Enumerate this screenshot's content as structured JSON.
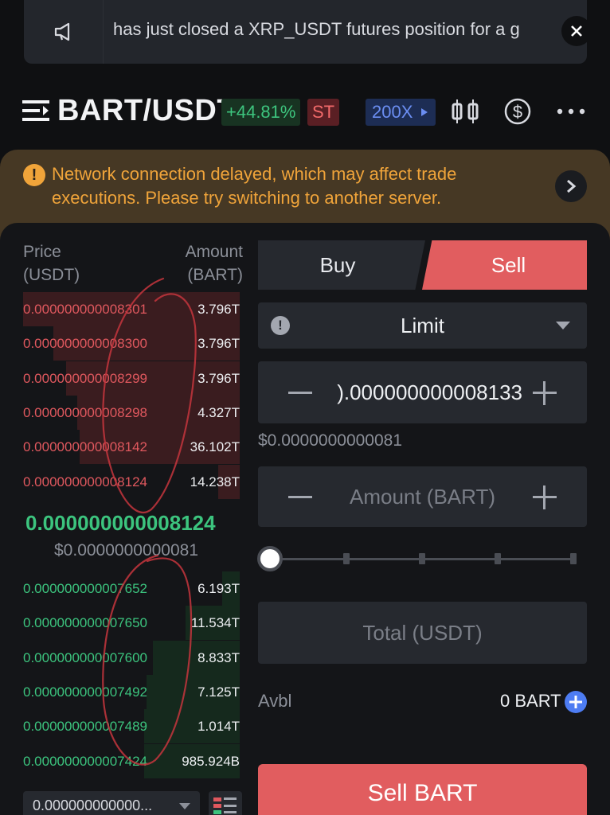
{
  "announcement": {
    "text": "has just closed a XRP_USDT futures position for a g",
    "icon": "speaker-icon"
  },
  "header": {
    "pair": "BART/USDT",
    "change": "+44.81%",
    "tag": "ST",
    "leverage": "200X",
    "colors": {
      "up": "#3cc47e",
      "down": "#e0585e",
      "accent": "#6b8ef2"
    }
  },
  "warning": {
    "text": "Network connection delayed, which may affect trade executions. Please try switching to another server."
  },
  "orderbook": {
    "price_header": [
      "Price",
      "(USDT)"
    ],
    "amount_header": [
      "Amount",
      "(BART)"
    ],
    "asks": [
      {
        "price": "0.000000000008301",
        "amount": "3.796T",
        "depth": 1.0
      },
      {
        "price": "0.000000000008300",
        "amount": "3.796T",
        "depth": 0.86
      },
      {
        "price": "0.000000000008299",
        "amount": "3.796T",
        "depth": 0.8
      },
      {
        "price": "0.000000000008298",
        "amount": "4.327T",
        "depth": 0.75
      },
      {
        "price": "0.000000000008142",
        "amount": "36.102T",
        "depth": 0.74
      },
      {
        "price": "0.000000000008124",
        "amount": "14.238T",
        "depth": 0.1
      }
    ],
    "last_price": "0.000000000008124",
    "last_price_usd": "$0.0000000000081",
    "bids": [
      {
        "price": "0.000000000007652",
        "amount": "6.193T",
        "depth": 0.08
      },
      {
        "price": "0.000000000007650",
        "amount": "11.534T",
        "depth": 0.25
      },
      {
        "price": "0.000000000007600",
        "amount": "8.833T",
        "depth": 0.4
      },
      {
        "price": "0.000000000007492",
        "amount": "7.125T",
        "depth": 0.43
      },
      {
        "price": "0.000000000007489",
        "amount": "1.014T",
        "depth": 0.44
      },
      {
        "price": "0.000000000007424",
        "amount": "985.924B",
        "depth": 0.44
      }
    ],
    "precision": "0.000000000000..."
  },
  "form": {
    "tab_buy": "Buy",
    "tab_sell": "Sell",
    "order_type": "Limit",
    "price_value": ").000000000008133",
    "price_usd": "$0.0000000000081",
    "amount_placeholder": "Amount (BART)",
    "slider_percent": 0,
    "total_placeholder": "Total (USDT)",
    "avbl_label": "Avbl",
    "avbl_value": "0 BART",
    "submit_label": "Sell BART"
  }
}
